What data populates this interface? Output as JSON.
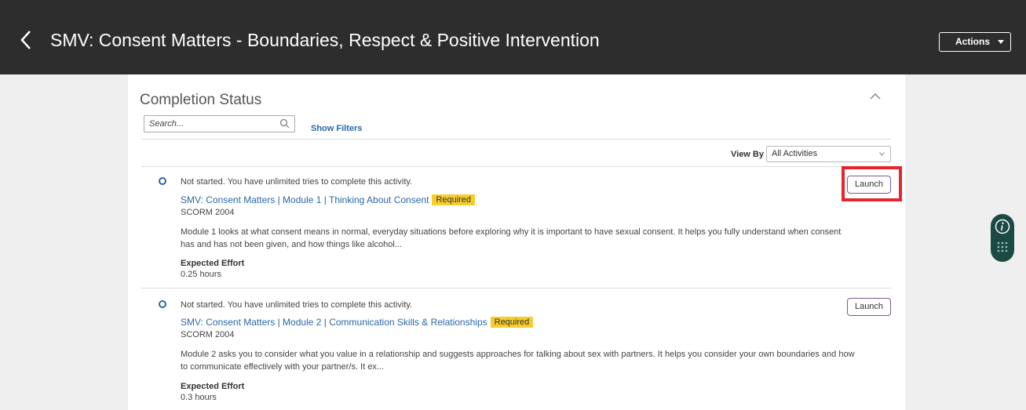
{
  "header": {
    "title": "SMV: Consent Matters - Boundaries, Respect & Positive Intervention",
    "actions_label": "Actions"
  },
  "section": {
    "title": "Completion Status",
    "search_placeholder": "Search...",
    "show_filters": "Show Filters",
    "view_by_label": "View By",
    "view_by_value": "All Activities"
  },
  "activities": [
    {
      "status": "Not started. You have unlimited tries to complete this activity.",
      "title": "SMV: Consent Matters | Module 1 | Thinking About Consent",
      "badge": "Required",
      "type": "SCORM 2004",
      "description": "Module 1 looks at what consent means in normal, everyday situations before exploring why it is important to have sexual consent. It helps you fully understand when consent has and has not been given, and how things like alcohol...",
      "effort_label": "Expected Effort",
      "effort_value": "0.25 hours",
      "launch_label": "Launch"
    },
    {
      "status": "Not started. You have unlimited tries to complete this activity.",
      "title": "SMV: Consent Matters | Module 2 | Communication Skills & Relationships",
      "badge": "Required",
      "type": "SCORM 2004",
      "description": "Module 2 asks you to consider what you value in a relationship and suggests approaches for talking about sex with partners. It helps you consider your own boundaries and how to communicate effectively with your partner/s. It ex...",
      "effort_label": "Expected Effort",
      "effort_value": "0.3 hours",
      "launch_label": "Launch"
    }
  ],
  "colors": {
    "header_bg": "#2d2d2d",
    "link": "#2a68a8",
    "badge": "#f6cd2b",
    "highlight": "#e3262d",
    "widget": "#1b4a44"
  },
  "icons": [
    "chevron-left-icon",
    "caret-down-icon",
    "chevron-up-icon",
    "search-icon",
    "info-icon",
    "grid-icon"
  ]
}
